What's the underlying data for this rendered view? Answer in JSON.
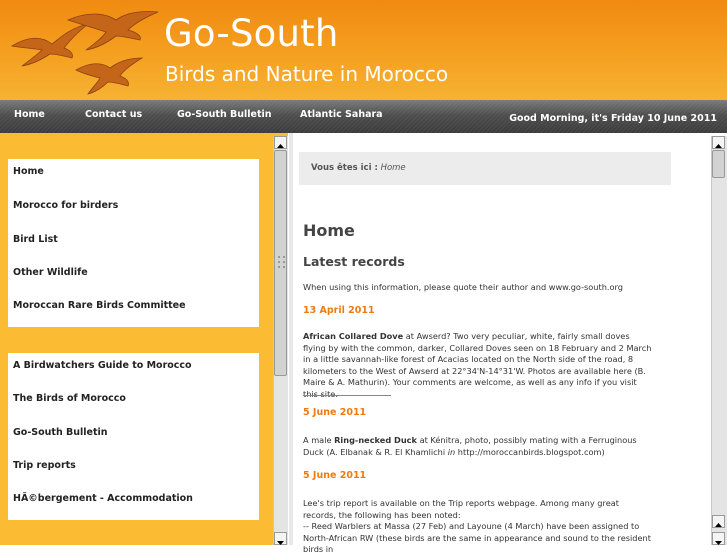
{
  "header": {
    "title": "Go-South",
    "subtitle": "Birds and Nature in Morocco",
    "logo_icon": "flying-birds-logo",
    "colors": {
      "orange": "#f5a020",
      "nav_dark": "#4e4e4e",
      "sidebar": "#fbbb33",
      "date_accent": "#f07a10"
    }
  },
  "nav": {
    "items": [
      "Home",
      "Contact us",
      "Go-South Bulletin",
      "Atlantic Sahara"
    ],
    "greeting": "Good Morning, it's Friday 10 June 2011"
  },
  "sidebar": {
    "menu1": [
      "Home",
      "Morocco for birders",
      "Bird List",
      "Other Wildlife",
      "Moroccan Rare Birds Committee"
    ],
    "menu2": [
      "A Birdwatchers Guide to Morocco",
      "The Birds of Morocco",
      "Go-South Bulletin",
      "Trip reports",
      "HÃ©bergement - Accommodation"
    ]
  },
  "content": {
    "breadcrumb_label": "Vous êtes ici :",
    "breadcrumb_page": "Home",
    "heading": "Home",
    "subheading": "Latest records",
    "intro": "When using this information, please quote their author and www.go-south.org",
    "records": [
      {
        "date": "13 April 2011",
        "species": "African Collared Dove",
        "text": " at Awserd? Two very peculiar, white, fairly small doves flying by with the common, darker, Collared Doves seen on 18 February and 2 March in a little savannah-like forest of Acacias located on the North side of the road, 8 kilometers to the West of Awserd at 22°34'N-14°31'W. Photos are available here (B. Maire & A. Mathurin). Your comments are welcome, as well as any info if you visit this site."
      },
      {
        "date": "5 June 2011",
        "text_before": "A male ",
        "species": "Ring-necked Duck",
        "text_mid": " at Kénitra, photo, possibly mating with a Ferruginous Duck (A. Elbanak & R. El Khamlichi ",
        "text_italic": "in",
        "text_after": " http://moroccanbirds.blogspot.com)"
      },
      {
        "date": "5 June 2011",
        "lines": [
          "Lee's trip report is available on the Trip reports webpage. Among many great records, the following has been noted:",
          "-- Reed Warblers at Massa (27 Feb) and Layoune (4 March) have been assigned to North-African RW (these birds are the same in appearance and sound to the resident birds in"
        ]
      }
    ]
  }
}
